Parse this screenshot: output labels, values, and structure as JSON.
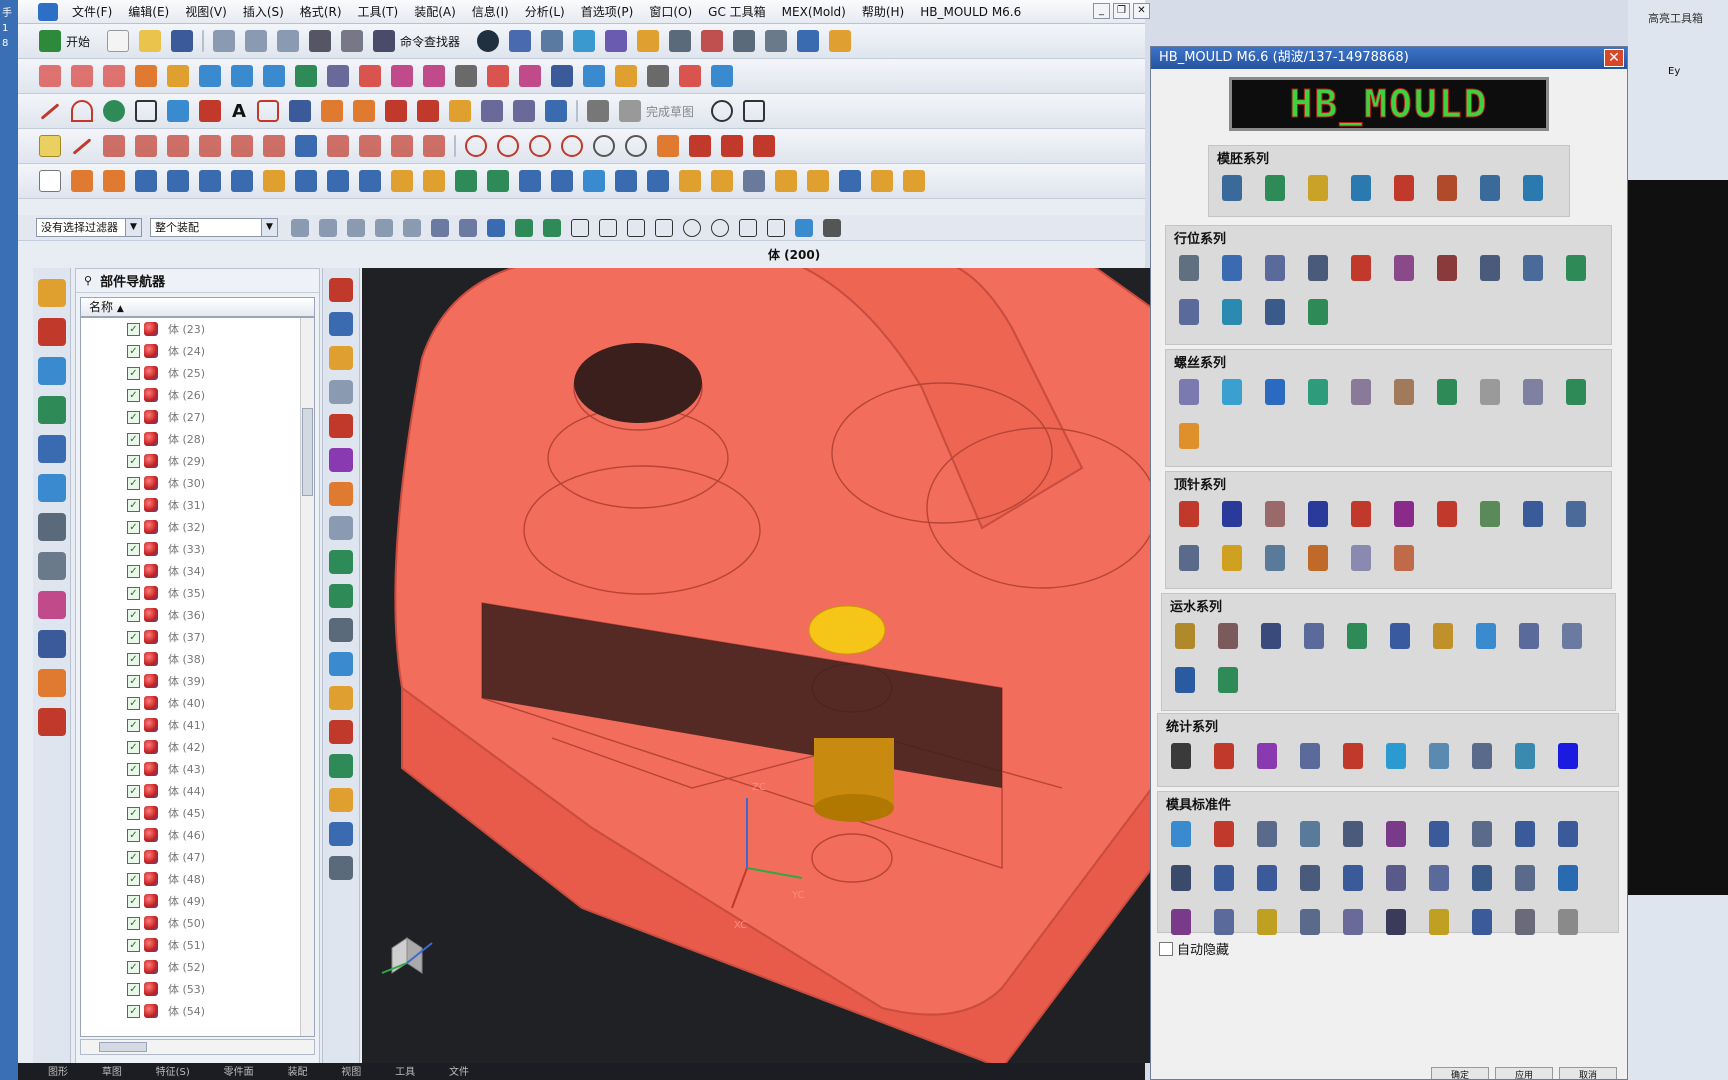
{
  "menu": {
    "items": [
      "文件(F)",
      "编辑(E)",
      "视图(V)",
      "插入(S)",
      "格式(R)",
      "工具(T)",
      "装配(A)",
      "信息(I)",
      "分析(L)",
      "首选项(P)",
      "窗口(O)",
      "GC 工具箱",
      "MEX(Mold)",
      "帮助(H)",
      "HB_MOULD M6.6"
    ]
  },
  "toolbar": {
    "start_label": "开始",
    "command_finder": "命令查找器",
    "finish_sketch": "完成草图"
  },
  "filters": {
    "selection_filter": "没有选择过滤器",
    "assembly_scope": "整个装配"
  },
  "viewport": {
    "title": "体 (200)",
    "axis_zc": "ZC",
    "axis_yc": "YC",
    "axis_xc": "XC"
  },
  "navigator": {
    "title": "部件导航器",
    "column_name": "名称",
    "rows": [
      "体 (23)",
      "体 (24)",
      "体 (25)",
      "体 (26)",
      "体 (27)",
      "体 (28)",
      "体 (29)",
      "体 (30)",
      "体 (31)",
      "体 (32)",
      "体 (33)",
      "体 (34)",
      "体 (35)",
      "体 (36)",
      "体 (37)",
      "体 (38)",
      "体 (39)",
      "体 (40)",
      "体 (41)",
      "体 (42)",
      "体 (43)",
      "体 (44)",
      "体 (45)",
      "体 (46)",
      "体 (47)",
      "体 (48)",
      "体 (49)",
      "体 (50)",
      "体 (51)",
      "体 (52)",
      "体 (53)",
      "体 (54)"
    ]
  },
  "hb_dialog": {
    "title": "HB_MOULD M6.6 (胡波/137-14978868)",
    "logo": "HB_MOULD",
    "autohide_label": "自动隐藏",
    "groups": [
      {
        "title": "模胚系列",
        "count": 8,
        "colors": [
          "#3a6a9a",
          "#2e8b57",
          "#c9a227",
          "#2a7ab0",
          "#c0392b",
          "#b04a2a",
          "#3a6a9a",
          "#2a7ab0"
        ]
      },
      {
        "title": "行位系列",
        "count": 14,
        "colors": [
          "#607080",
          "#3a6ab0",
          "#5a6a9a",
          "#4a5a7a",
          "#c0392b",
          "#8a4a8a",
          "#8a3a3a",
          "#4a5a7a",
          "#4a6a9a",
          "#2e8b57",
          "#5a6a9a",
          "#2a8ab0",
          "#3a5a8a",
          "#2e8b57"
        ]
      },
      {
        "title": "螺丝系列",
        "count": 11,
        "colors": [
          "#7a7ab0",
          "#3aa0d0",
          "#2a6ac0",
          "#2e9b7a",
          "#8a7a9a",
          "#a07a5a",
          "#2e8b57",
          "#9a9a9a",
          "#8080a0",
          "#2e8b57",
          "#e0902a"
        ]
      },
      {
        "title": "顶针系列",
        "count": 16,
        "colors": [
          "#c0392b",
          "#2a3a9a",
          "#9a6a6a",
          "#2a3a9a",
          "#c0392b",
          "#8a2a8a",
          "#c0392b",
          "#5a8a5a",
          "#3a5a9a",
          "#4a6a9a",
          "#5a6a8a",
          "#d0a020",
          "#5a7a9a",
          "#c06a2a",
          "#8a8ab0",
          "#c06a4a"
        ]
      },
      {
        "title": "运水系列",
        "count": 12,
        "colors": [
          "#b08a2a",
          "#7a5a5a",
          "#3a4a7a",
          "#5a6a9a",
          "#2e8b57",
          "#3a5aa0",
          "#c0902a",
          "#3a8ad0",
          "#5a6a9a",
          "#6a7aa0",
          "#2a5aa0",
          "#2e8b57"
        ]
      },
      {
        "title": "统计系列",
        "count": 10,
        "colors": [
          "#3a3a3a",
          "#c0392b",
          "#8a3ab0",
          "#5a6a9a",
          "#c0392b",
          "#2a9ad0",
          "#5a8ab0",
          "#5a6a8a",
          "#3a8ab0",
          "#1a1ae0"
        ]
      },
      {
        "title": "模具标准件",
        "count": 30,
        "colors": [
          "#3a8ad0",
          "#c0392b",
          "#5a6a8a",
          "#5a7a9a",
          "#4a5a7a",
          "#7a3a8a",
          "#3a5a9a",
          "#5a6a8a",
          "#3a5a9a",
          "#3a5a9a",
          "#3a4a6a",
          "#3a5a9a",
          "#3a5a9a",
          "#4a5a7a",
          "#3a5a9a",
          "#5a5a8a",
          "#5a6a9a",
          "#3a5a8a",
          "#5a6a8a",
          "#2a6ab0",
          "#7a3a8a",
          "#5a6a9a",
          "#c0a020",
          "#5a6a8a",
          "#6a6a9a",
          "#3a3a5a",
          "#c0a020",
          "#3a5a9a",
          "#6a6a7a",
          "#8a8a8a"
        ]
      }
    ],
    "buttons": [
      "确定",
      "应用",
      "取消"
    ]
  },
  "statusbar": {
    "items": [
      "图形",
      "草图",
      "特征(S)",
      "零件面",
      "装配",
      "视图",
      "工具",
      "文件"
    ]
  },
  "right_panel": {
    "label": "高亮工具箱",
    "tab": "Ey"
  },
  "colors": {
    "model": "#f26d5b",
    "model_edge": "#c94c3f",
    "viewport_bg": "#1f2124",
    "highlight": "#f5c518",
    "dialog_title": "#2f61b4"
  }
}
